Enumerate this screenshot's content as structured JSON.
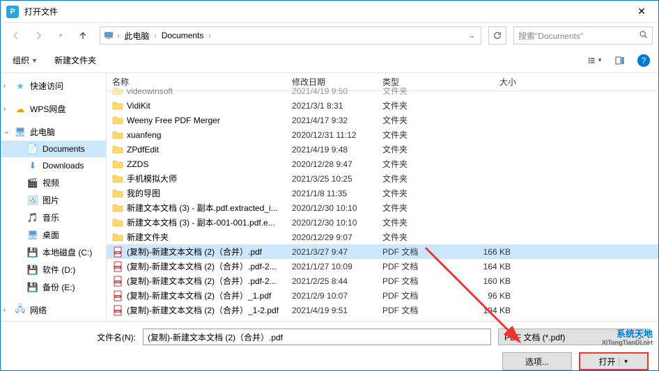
{
  "window": {
    "title": "打开文件",
    "app_letter": "P"
  },
  "nav": {
    "breadcrumbs": [
      "此电脑",
      "Documents"
    ],
    "search_placeholder": "搜索\"Documents\""
  },
  "toolbar": {
    "organize": "组织",
    "newfolder": "新建文件夹"
  },
  "sidebar": {
    "quick_access": "快速访问",
    "wps": "WPS网盘",
    "thispc": "此电脑",
    "documents": "Documents",
    "downloads": "Downloads",
    "videos": "视频",
    "pictures": "图片",
    "music": "音乐",
    "desktop": "桌面",
    "local_c": "本地磁盘 (C:)",
    "soft_d": "软件 (D:)",
    "backup_e": "备份 (E:)",
    "network": "网络"
  },
  "columns": {
    "name": "名称",
    "date": "修改日期",
    "type": "类型",
    "size": "大小"
  },
  "files": [
    {
      "name": "VidiKit",
      "date": "2021/3/1 8:31",
      "type": "文件夹",
      "size": "",
      "kind": "folder"
    },
    {
      "name": "Weeny Free PDF Merger",
      "date": "2021/4/17 9:32",
      "type": "文件夹",
      "size": "",
      "kind": "folder"
    },
    {
      "name": "xuanfeng",
      "date": "2020/12/31 11:12",
      "type": "文件夹",
      "size": "",
      "kind": "folder"
    },
    {
      "name": "ZPdfEdit",
      "date": "2021/4/19 9:48",
      "type": "文件夹",
      "size": "",
      "kind": "folder"
    },
    {
      "name": "ZZDS",
      "date": "2020/12/28 9:47",
      "type": "文件夹",
      "size": "",
      "kind": "folder"
    },
    {
      "name": "手机模拟大师",
      "date": "2021/3/25 10:25",
      "type": "文件夹",
      "size": "",
      "kind": "folder"
    },
    {
      "name": "我的导图",
      "date": "2021/1/8 11:35",
      "type": "文件夹",
      "size": "",
      "kind": "folder"
    },
    {
      "name": "新建文本文档 (3) - 副本.pdf.extracted_i...",
      "date": "2020/12/30 10:10",
      "type": "文件夹",
      "size": "",
      "kind": "folder"
    },
    {
      "name": "新建文本文档 (3) - 副本-001-001.pdf.e...",
      "date": "2020/12/30 10:10",
      "type": "文件夹",
      "size": "",
      "kind": "folder"
    },
    {
      "name": "新建文件夹",
      "date": "2020/12/29 9:07",
      "type": "文件夹",
      "size": "",
      "kind": "folder"
    },
    {
      "name": "(复制)-新建文本文档 (2)（合并）.pdf",
      "date": "2021/3/27 9:47",
      "type": "PDF 文档",
      "size": "166 KB",
      "kind": "pdf",
      "selected": true
    },
    {
      "name": "(复制)-新建文本文档 (2)（合并）.pdf-2...",
      "date": "2021/1/27 10:09",
      "type": "PDF 文档",
      "size": "164 KB",
      "kind": "pdf"
    },
    {
      "name": "(复制)-新建文本文档 (2)（合并）.pdf-2...",
      "date": "2021/2/25 8:44",
      "type": "PDF 文档",
      "size": "160 KB",
      "kind": "pdf"
    },
    {
      "name": "(复制)-新建文本文档 (2)（合并）_1.pdf",
      "date": "2021/2/9 10:07",
      "type": "PDF 文档",
      "size": "96 KB",
      "kind": "pdf"
    },
    {
      "name": "(复制)-新建文本文档 (2)（合并）_1-2.pdf",
      "date": "2021/4/19 9:51",
      "type": "PDF 文档",
      "size": "194 KB",
      "kind": "pdf"
    }
  ],
  "truncated_first": {
    "name": "videowinsoft",
    "date": "2021/4/19 9:50",
    "type": "文件夹"
  },
  "footer": {
    "filename_label": "文件名(N):",
    "filename_value": "(复制)-新建文本文档 (2)（合并）.pdf",
    "filter": "PDF 文档 (*.pdf)",
    "options": "选项...",
    "open": "打开"
  },
  "watermark": {
    "l1": "系统天地",
    "l2": "XiTongTianDi.net"
  }
}
